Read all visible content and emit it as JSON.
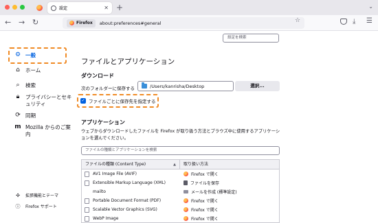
{
  "tab": {
    "title": "設定"
  },
  "urlbar": {
    "identity_label": "Firefox",
    "url": "about:preferences#general"
  },
  "search": {
    "placeholder": "設定を検索"
  },
  "sidebar": {
    "items": [
      {
        "label": "一般",
        "icon": "gear-icon",
        "active": true
      },
      {
        "label": "ホーム",
        "icon": "home-icon"
      },
      {
        "label": "検索",
        "icon": "search-icon"
      },
      {
        "label": "プライバシーとセキュリティ",
        "icon": "lock-icon"
      },
      {
        "label": "同期",
        "icon": "sync-icon"
      },
      {
        "label": "Mozilla からのご案内",
        "icon": "mozilla-icon"
      }
    ],
    "footer": [
      {
        "label": "拡張機能とテーマ",
        "icon": "puzzle-icon"
      },
      {
        "label": "Firefox サポート",
        "icon": "help-icon"
      }
    ]
  },
  "main": {
    "heading": "ファイルとアプリケーション",
    "downloads": {
      "heading": "ダウンロード",
      "save_label": "次のフォルダーに保存する",
      "folder_path": "/Users/kanrisha/Desktop",
      "choose_button": "選択...",
      "ask_checkbox_label": "ファイルごとに保存先を指定する",
      "ask_checked": true
    },
    "applications": {
      "heading": "アプリケーション",
      "description": "ウェブからダウンロードしたファイルを Firefox が取り扱う方法とブラウズ中に使用するアプリケーションを選んでください。",
      "filter_placeholder": "ファイルの種類とアプリケーションを検索",
      "columns": [
        "ファイルの種類 (Content Type)",
        "取り扱い方法"
      ],
      "rows": [
        {
          "type": "AV1 Image File (AVIF)",
          "action": "Firefox で開く",
          "action_icon": "firefox-icon"
        },
        {
          "type": "Extensible Markup Language (XML)",
          "action": "ファイルを保存",
          "action_icon": "save-icon"
        },
        {
          "type": "mailto",
          "action": "メールを作成 (標準設定)",
          "action_icon": "mail-icon"
        },
        {
          "type": "Portable Document Format (PDF)",
          "action": "Firefox で開く",
          "action_icon": "firefox-icon"
        },
        {
          "type": "Scalable Vector Graphics (SVG)",
          "action": "Firefox で開く",
          "action_icon": "firefox-icon"
        },
        {
          "type": "WebP Image",
          "action": "Firefox で開く",
          "action_icon": "firefox-icon"
        }
      ]
    }
  },
  "colors": {
    "accent": "#0061e0",
    "highlight": "#f08a24"
  }
}
